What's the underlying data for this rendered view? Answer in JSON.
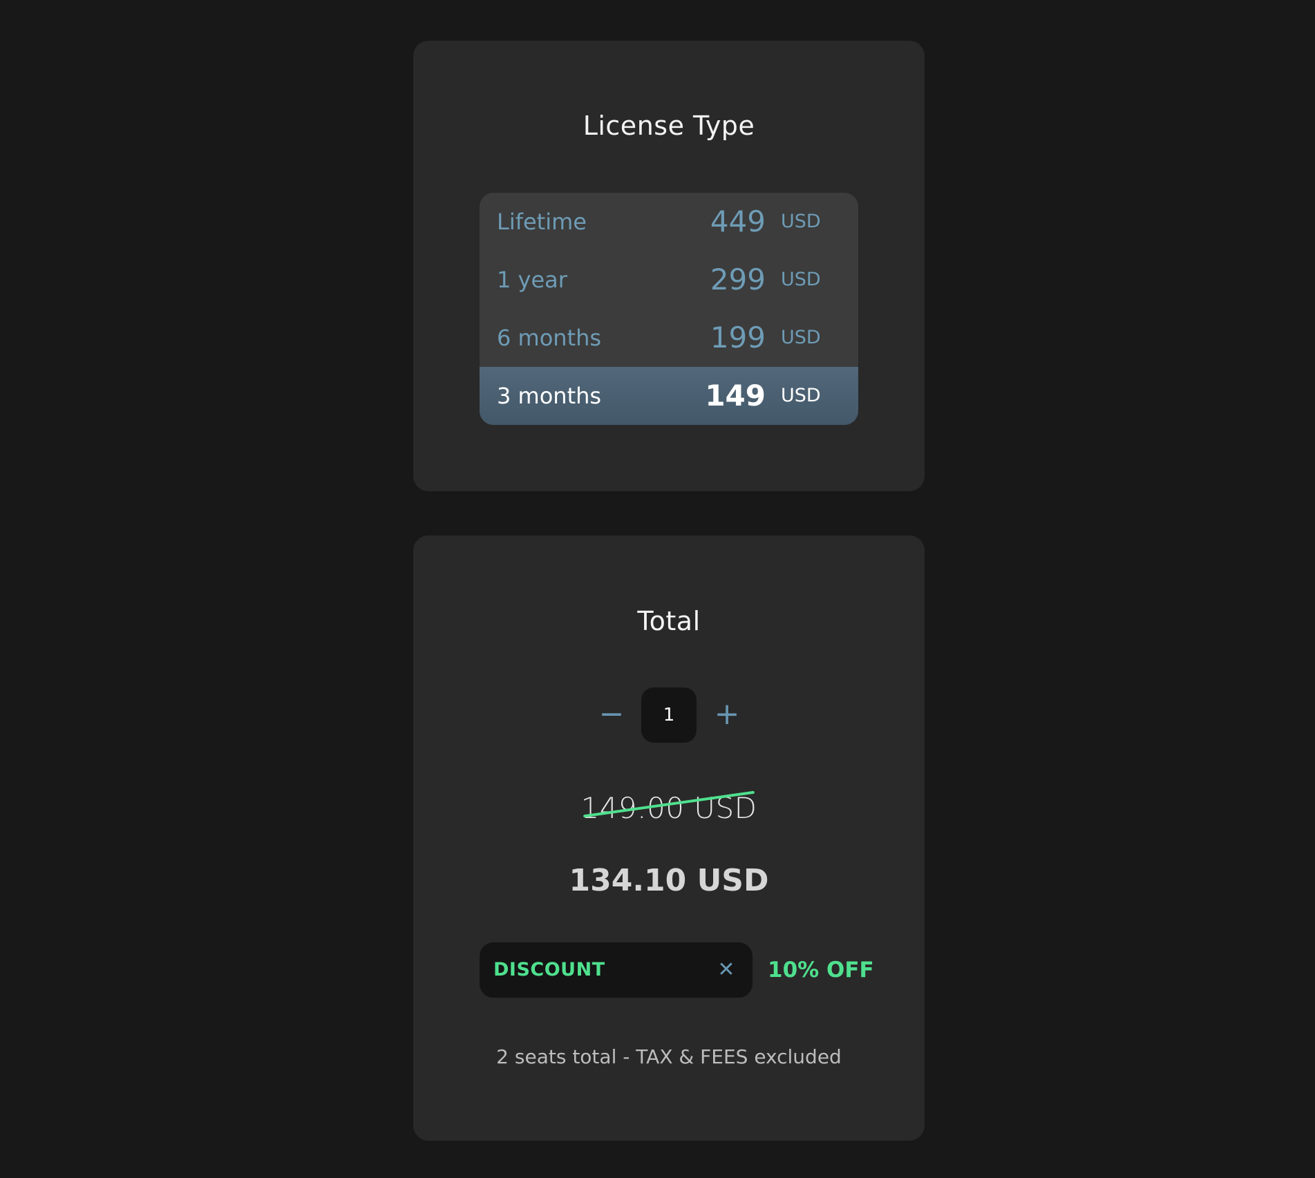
{
  "license_card": {
    "title": "License Type",
    "options": [
      {
        "label": "Lifetime",
        "price": "449",
        "currency": "USD",
        "selected": false
      },
      {
        "label": "1 year",
        "price": "299",
        "currency": "USD",
        "selected": false
      },
      {
        "label": "6 months",
        "price": "199",
        "currency": "USD",
        "selected": false
      },
      {
        "label": "3 months",
        "price": "149",
        "currency": "USD",
        "selected": true
      }
    ]
  },
  "total_card": {
    "title": "Total",
    "stepper": {
      "minus_symbol": "−",
      "value": "1",
      "plus_symbol": "+"
    },
    "original_price": "149.00 USD",
    "final_price": "134.10 USD",
    "discount": {
      "code": "DISCOUNT",
      "clear_symbol": "✕",
      "badge": "10% OFF"
    },
    "footnote": "2 seats total - TAX & FEES excluded"
  },
  "colors": {
    "background": "#181818",
    "card": "#292929",
    "accent_blue": "#6e9cb6",
    "accent_green": "#4fe08e",
    "selected_row": "#4b6072"
  }
}
